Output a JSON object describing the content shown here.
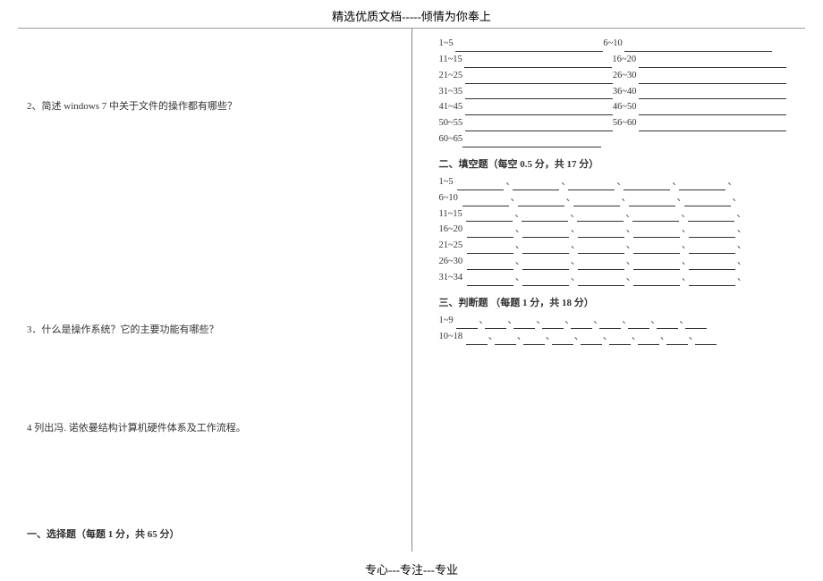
{
  "header": "精选优质文档-----倾情为你奉上",
  "footer": "专心---专注---专业",
  "left": {
    "q2": "2、简述 windows 7 中关于文件的操作都有哪些？",
    "q3": "3．什么是操作系统？它的主要功能有哪些？",
    "q4": "4 列出冯. 诺依曼结构计算机硬件体系及工作流程。",
    "sec1": "一、选择题（每题 1 分，共 65 分）"
  },
  "right": {
    "choice_rows": [
      {
        "a": "1~5",
        "b": "6~10"
      },
      {
        "a": "11~15",
        "b": "16~20"
      },
      {
        "a": "21~25",
        "b": "26~30"
      },
      {
        "a": "31~35",
        "b": "36~40"
      },
      {
        "a": "41~45",
        "b": "46~50"
      },
      {
        "a": "50~55",
        "b": "56~60"
      },
      {
        "a": "60~65",
        "b": ""
      }
    ],
    "fill_title": "二、填空题（每空 0.5 分，共 17 分）",
    "fill_rows": [
      "1~5",
      "6~10",
      "11~15",
      "16~20",
      "21~25",
      "26~30",
      "31~34"
    ],
    "judge_title": "三、判断题 （每题 1 分，共 18 分）",
    "judge_rows": [
      "1~9",
      "10~18"
    ],
    "sep": "、"
  }
}
